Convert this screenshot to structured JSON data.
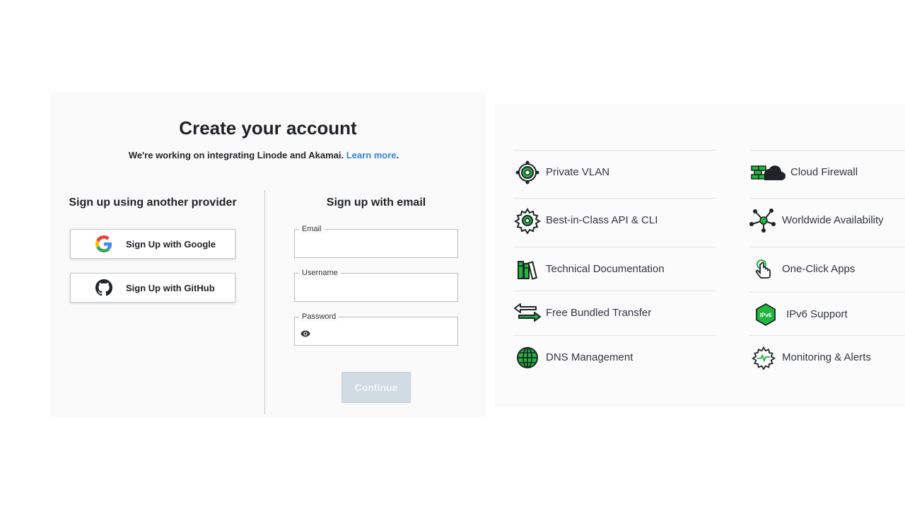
{
  "header": {
    "title": "Create your account",
    "subtitle": "We're working on integrating Linode and Akamai.",
    "learn_more": "Learn more",
    "period": "."
  },
  "providers": {
    "heading": "Sign up using another provider",
    "google_label": "Sign Up with Google",
    "github_label": "Sign Up with GitHub"
  },
  "email_signup": {
    "heading": "Sign up with email",
    "email_label": "Email",
    "email_value": "",
    "username_label": "Username",
    "username_value": "",
    "password_label": "Password",
    "password_value": "",
    "continue_label": "Continue"
  },
  "features": {
    "left": [
      {
        "label": "Private VLAN",
        "icon": "network-hub-icon"
      },
      {
        "label": "Best-in-Class API & CLI",
        "icon": "gear-icon"
      },
      {
        "label": "Technical Documentation",
        "icon": "books-icon"
      },
      {
        "label": "Free Bundled Transfer",
        "icon": "transfer-arrows-icon"
      },
      {
        "label": "DNS Management",
        "icon": "globe-icon"
      }
    ],
    "right": [
      {
        "label": "Cloud Firewall",
        "icon": "cloud-firewall-icon"
      },
      {
        "label": "Worldwide Availability",
        "icon": "nodes-icon"
      },
      {
        "label": "One-Click Apps",
        "icon": "pointer-click-icon"
      },
      {
        "label": "IPv6 Support",
        "icon": "ipv6-hexagon-icon",
        "badge": "IPv6"
      },
      {
        "label": "Monitoring & Alerts",
        "icon": "monitoring-gear-icon"
      }
    ]
  },
  "colors": {
    "accent_green": "#1fb83c",
    "link_blue": "#3683dc",
    "disabled_button": "#d1dbe4"
  }
}
